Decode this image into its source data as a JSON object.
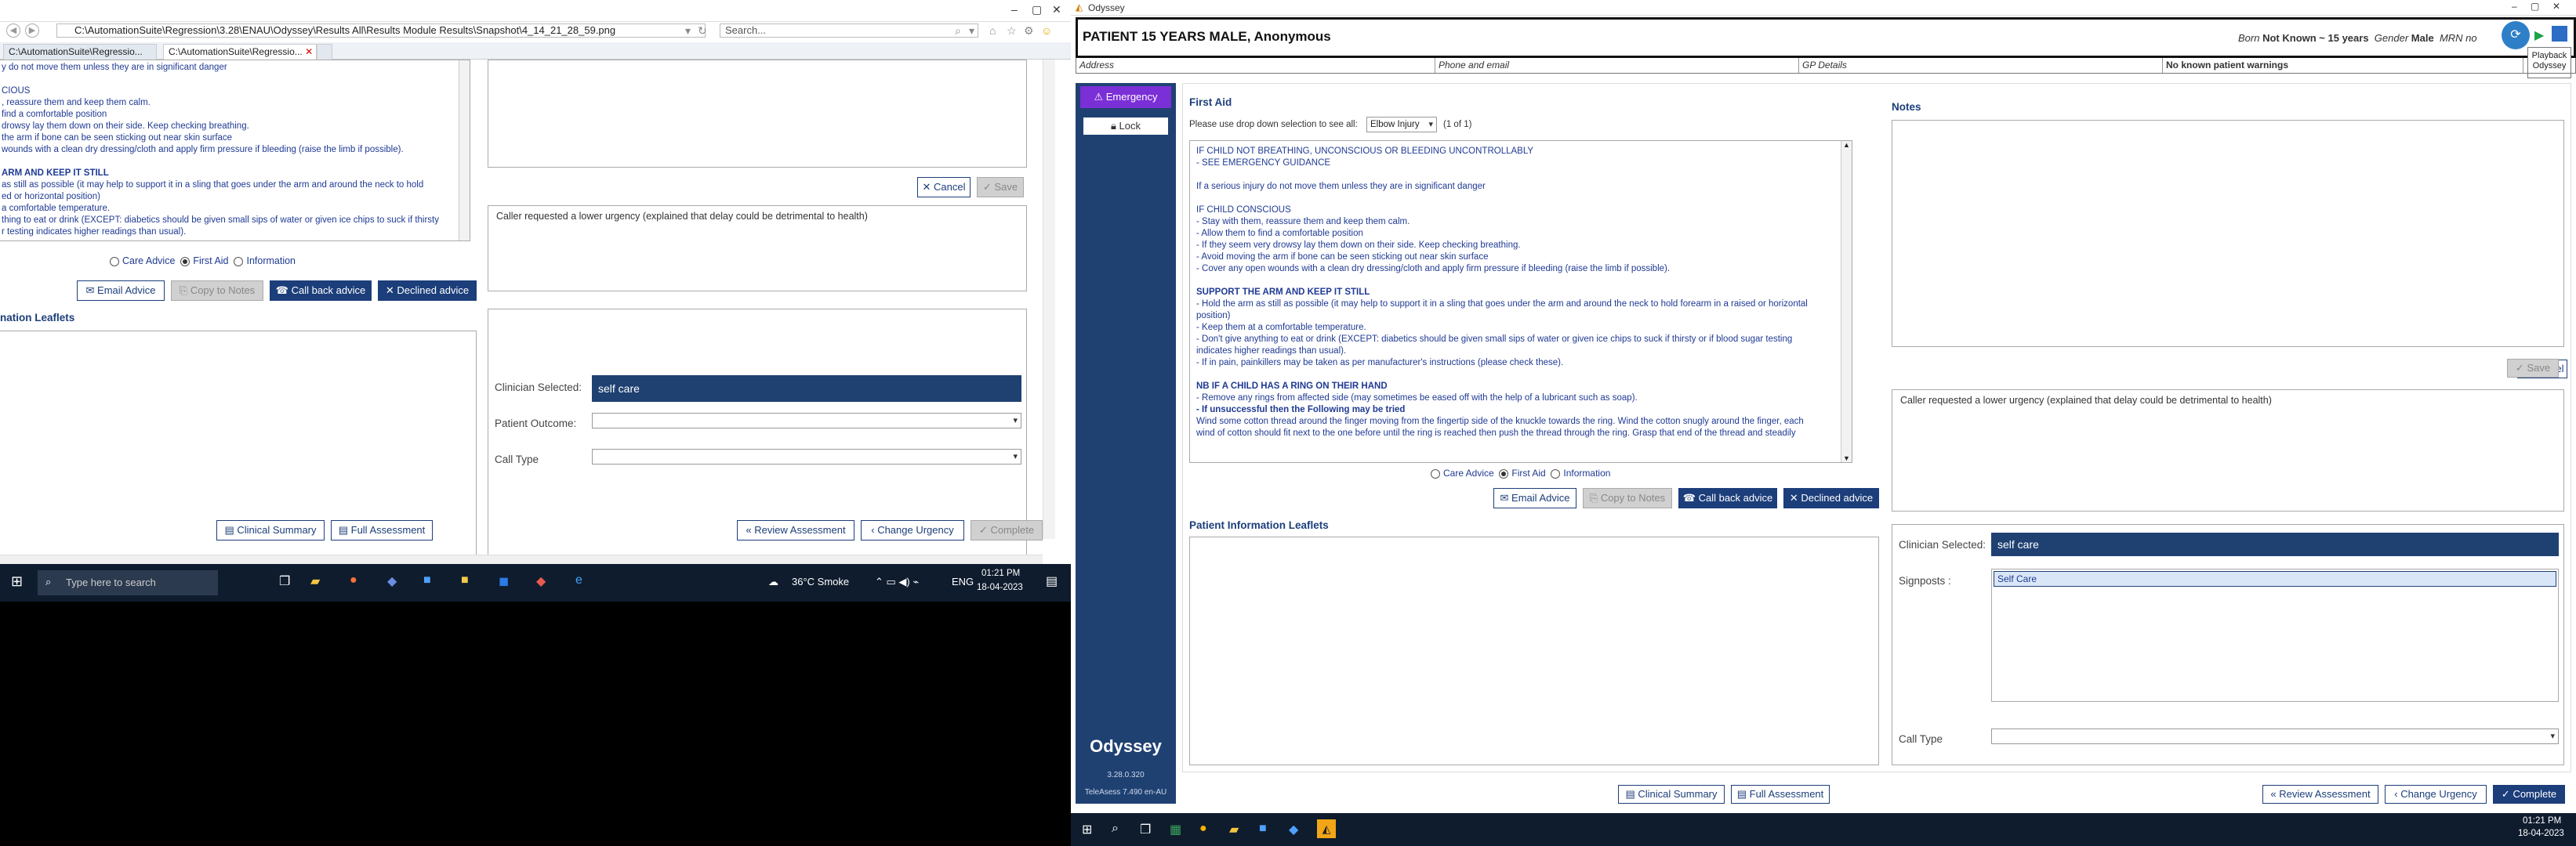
{
  "ie": {
    "address": "C:\\AutomationSuite\\Regression\\3.28\\ENAU\\Odyssey\\Results All\\Results Module Results\\Snapshot\\4_14_21_28_59.png",
    "search_placeholder": "Search...",
    "tabs": [
      "C:\\AutomationSuite\\Regressio...",
      "C:\\AutomationSuite\\Regressio..."
    ],
    "icons": [
      "back-icon",
      "forward-icon",
      "refresh-icon",
      "home-icon",
      "star-icon",
      "gear-icon",
      "smiley-icon"
    ]
  },
  "left": {
    "first_aid_lines": [
      {
        "t": "y do not move them unless they are in significant danger",
        "h": false
      },
      {
        "t": "",
        "h": false
      },
      {
        "t": "CIOUS",
        "h": false
      },
      {
        "t": ", reassure them and keep them calm.",
        "h": false
      },
      {
        "t": " find a comfortable position",
        "h": false
      },
      {
        "t": " drowsy lay them down on their side. Keep checking breathing.",
        "h": false
      },
      {
        "t": " the arm if bone can be seen sticking out near skin surface",
        "h": false
      },
      {
        "t": " wounds with a clean dry dressing/cloth and apply firm pressure if bleeding (raise the limb if possible).",
        "h": false
      },
      {
        "t": "",
        "h": false
      },
      {
        "t": "ARM AND KEEP IT STILL",
        "h": true
      },
      {
        "t": "as still as possible (it may help to support it in a sling that goes under the arm and around the neck to hold",
        "h": false
      },
      {
        "t": "ed or horizontal position)",
        "h": false
      },
      {
        "t": "a comfortable temperature.",
        "h": false
      },
      {
        "t": "thing to eat or drink (EXCEPT: diabetics should be given small sips of water or given ice chips to suck if thirsty",
        "h": false
      },
      {
        "t": "r testing indicates higher readings than usual).",
        "h": false
      }
    ],
    "radios": [
      "Care Advice",
      "First Aid",
      "Information"
    ],
    "buttons": {
      "email": "Email Advice",
      "copy": "Copy to Notes",
      "callback": "Call back advice",
      "declined": "Declined advice",
      "cancel": "Cancel",
      "save": "Save"
    },
    "leaflets_title": "nation Leaflets",
    "urgency_note": "Caller requested a lower urgency (explained that delay could be detrimental to health)",
    "clinician_label": "Clinician Selected:",
    "clinician_value": "self care",
    "outcome_label": "Patient Outcome:",
    "calltype_label": "Call Type",
    "bottom": {
      "clinical": "Clinical Summary",
      "full": "Full Assessment",
      "review": "Review Assessment",
      "change": "Change Urgency",
      "complete": "Complete"
    }
  },
  "taskbar1": {
    "search": "Type here to search",
    "weather": "36°C  Smoke",
    "lang": "ENG",
    "time": "01:21 PM",
    "date": "18-04-2023"
  },
  "ody": {
    "window_title": "Odyssey",
    "patient": "PATIENT 15 YEARS MALE, Anonymous",
    "born_label": "Born",
    "born_value": "Not Known ~ 15 years",
    "gender_label": "Gender",
    "gender_value": "Male",
    "mrn_label": "MRN no",
    "playback_tooltip": "Playback\nOdyssey",
    "info": {
      "address": "Address",
      "phone": "Phone and email",
      "gp": "GP Details",
      "warnings": "No known patient warnings"
    },
    "side": {
      "emergency": "Emergency",
      "lock": "Lock",
      "brand": "Odyssey",
      "version": "3.28.0.320",
      "teleassess": "TeleAsess 7.490 en-AU"
    },
    "first_aid_title": "First Aid",
    "dropdown_prompt": "Please use drop down selection to see all:",
    "dropdown_value": "Elbow Injury",
    "dropdown_count": "(1 of 1)",
    "first_aid_lines": [
      {
        "t": "IF CHILD NOT BREATHING, UNCONSCIOUS OR BLEEDING UNCONTROLLABLY",
        "h": false
      },
      {
        "t": "- SEE EMERGENCY GUIDANCE",
        "h": false
      },
      {
        "t": "",
        "h": false
      },
      {
        "t": "If a serious injury do not move them unless they are in significant danger",
        "h": false
      },
      {
        "t": "",
        "h": false
      },
      {
        "t": "IF CHILD CONSCIOUS",
        "h": false
      },
      {
        "t": "- Stay with them, reassure them and keep them calm.",
        "h": false
      },
      {
        "t": "- Allow them to find a comfortable position",
        "h": false
      },
      {
        "t": "- If they seem very drowsy lay them down on their side. Keep checking breathing.",
        "h": false
      },
      {
        "t": "- Avoid moving the arm if bone can be seen sticking out near skin surface",
        "h": false
      },
      {
        "t": "- Cover any open wounds with a clean dry dressing/cloth and apply firm pressure if bleeding (raise the limb if possible).",
        "h": false
      },
      {
        "t": "",
        "h": false
      },
      {
        "t": "SUPPORT THE ARM AND KEEP IT STILL",
        "h": true
      },
      {
        "t": "- Hold the arm as still as possible (it may help to support it in a sling that goes under the arm and around the neck to hold forearm in a raised or horizontal",
        "h": false
      },
      {
        "t": "position)",
        "h": false
      },
      {
        "t": "- Keep them at a comfortable temperature.",
        "h": false
      },
      {
        "t": "- Don't give anything to eat or drink (EXCEPT: diabetics should be given small sips of water or given ice chips to suck if thirsty or if blood sugar testing",
        "h": false
      },
      {
        "t": "indicates higher readings than usual).",
        "h": false
      },
      {
        "t": "- If in pain, painkillers may be taken as per manufacturer's instructions (please check these).",
        "h": false
      },
      {
        "t": "",
        "h": false
      },
      {
        "t": "NB IF A CHILD HAS A RING ON THEIR HAND",
        "h": true
      },
      {
        "t": "- Remove any rings from affected side (may sometimes be eased off with the help of a lubricant such as soap).",
        "h": false
      },
      {
        "t": "- If unsuccessful then the Following may be tried",
        "h": true
      },
      {
        "t": "Wind some cotton thread around the finger moving from the fingertip side of the knuckle towards the ring. Wind the cotton snugly around the finger, each",
        "h": false
      },
      {
        "t": "wind of cotton should fit next to the one before until the ring is reached then push the thread through the ring. Grasp that end of the thread and steadily",
        "h": false
      }
    ],
    "radios": [
      "Care Advice",
      "First Aid",
      "Information"
    ],
    "buttons": {
      "email": "Email Advice",
      "copy": "Copy to Notes",
      "callback": "Call back advice",
      "declined": "Declined advice",
      "cancel": "Cancel",
      "save": "Save"
    },
    "leaflets_title": "Patient Information Leaflets",
    "notes_title": "Notes",
    "urgency_note": "Caller requested a lower urgency (explained that delay could be detrimental to health)",
    "clinician_label": "Clinician Selected:",
    "clinician_value": "self care",
    "signposts_label": "Signposts :",
    "signposts_value": "Self Care",
    "calltype_label": "Call Type",
    "bottom": {
      "clinical": "Clinical Summary",
      "full": "Full Assessment",
      "review": "Review Assessment",
      "change": "Change Urgency",
      "complete": "Complete"
    }
  },
  "taskbar2": {
    "time": "01:21 PM",
    "date": "18-04-2023"
  }
}
